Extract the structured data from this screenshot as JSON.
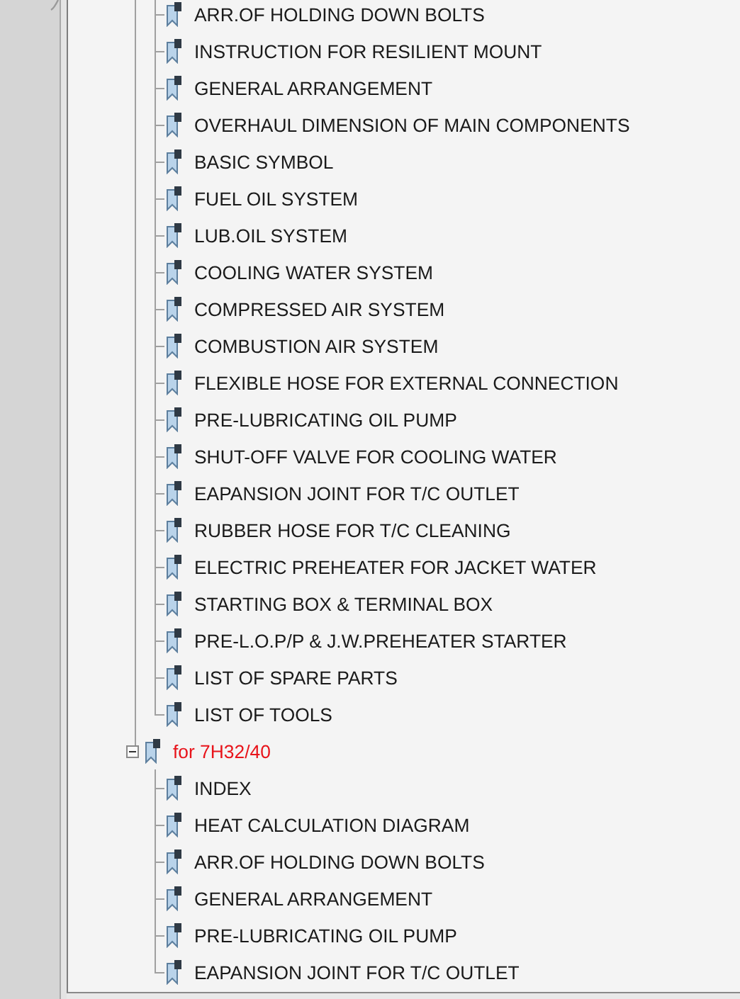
{
  "bookmarks": [
    {
      "children": [
        {
          "label": "ARR.OF HOLDING DOWN BOLTS",
          "color": "#1a1a1a"
        },
        {
          "label": "INSTRUCTION FOR RESILIENT MOUNT",
          "color": "#1a1a1a"
        },
        {
          "label": "GENERAL ARRANGEMENT",
          "color": "#1a1a1a"
        },
        {
          "label": "OVERHAUL DIMENSION OF MAIN COMPONENTS",
          "color": "#1a1a1a"
        },
        {
          "label": "BASIC SYMBOL",
          "color": "#1a1a1a"
        },
        {
          "label": "FUEL OIL SYSTEM",
          "color": "#1a1a1a"
        },
        {
          "label": "LUB.OIL SYSTEM",
          "color": "#1a1a1a"
        },
        {
          "label": "COOLING WATER SYSTEM",
          "color": "#1a1a1a"
        },
        {
          "label": "COMPRESSED AIR SYSTEM",
          "color": "#1a1a1a"
        },
        {
          "label": "COMBUSTION AIR SYSTEM",
          "color": "#1a1a1a"
        },
        {
          "label": "FLEXIBLE HOSE FOR EXTERNAL CONNECTION",
          "color": "#1a1a1a"
        },
        {
          "label": "PRE-LUBRICATING OIL PUMP",
          "color": "#1a1a1a"
        },
        {
          "label": "SHUT-OFF VALVE FOR COOLING WATER",
          "color": "#1a1a1a"
        },
        {
          "label": "EAPANSION JOINT FOR T/C OUTLET",
          "color": "#1a1a1a"
        },
        {
          "label": "RUBBER HOSE FOR T/C CLEANING",
          "color": "#1a1a1a"
        },
        {
          "label": "ELECTRIC PREHEATER FOR JACKET WATER",
          "color": "#1a1a1a"
        },
        {
          "label": "STARTING BOX & TERMINAL BOX",
          "color": "#1a1a1a"
        },
        {
          "label": "PRE-L.O.P/P & J.W.PREHEATER STARTER",
          "color": "#1a1a1a"
        },
        {
          "label": "LIST OF SPARE PARTS",
          "color": "#1a1a1a"
        },
        {
          "label": "LIST OF TOOLS",
          "color": "#1a1a1a"
        }
      ]
    },
    {
      "label": "for 7H32/40",
      "color": "#e8141b",
      "expanded": true,
      "children": [
        {
          "label": "INDEX",
          "color": "#1a1a1a"
        },
        {
          "label": "HEAT CALCULATION DIAGRAM",
          "color": "#1a1a1a"
        },
        {
          "label": "ARR.OF HOLDING DOWN BOLTS",
          "color": "#1a1a1a"
        },
        {
          "label": "GENERAL ARRANGEMENT",
          "color": "#1a1a1a"
        },
        {
          "label": "PRE-LUBRICATING OIL PUMP",
          "color": "#1a1a1a"
        },
        {
          "label": "EAPANSION JOINT FOR T/C OUTLET",
          "color": "#1a1a1a"
        }
      ]
    }
  ]
}
